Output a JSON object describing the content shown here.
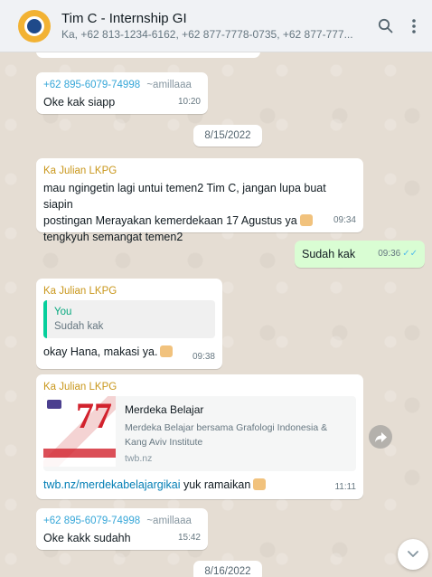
{
  "header": {
    "title": "Tim C - Internship GI",
    "members": "Ka, +62 813-1234-6162, +62 877-7778-0735, +62 877-777...",
    "search_icon": "search-icon",
    "menu_icon": "menu-icon"
  },
  "messages": [
    {
      "sender_phone": "+62 895-6079-74998",
      "sender_alias": "~amillaaa",
      "text": "Oke kak siapp",
      "time": "10:20"
    },
    {
      "date": "8/15/2022"
    },
    {
      "sender": "Ka Julian LKPG",
      "text_line1": "mau ngingetin lagi untui temen2 Tim C, jangan lupa buat siapin",
      "text_line2": "postingan Merayakan kemerdekaan 17 Agustus ya",
      "text_line3": "tengkyuh semangat temen2",
      "time": "09:34"
    },
    {
      "text": "Sudah kak",
      "time": "09:36",
      "ticks": "✓✓"
    },
    {
      "sender": "Ka Julian LKPG",
      "quote_author": "You",
      "quote_text": "Sudah kak",
      "text": "okay Hana, makasi ya.",
      "time": "09:38"
    },
    {
      "sender": "Ka Julian LKPG",
      "link_title": "Merdeka Belajar",
      "link_desc": "Merdeka Belajar bersama Grafologi Indonesia & Kang Aviv Institute",
      "link_domain": "twb.nz",
      "url": "twb.nz/merdekabelajargikai",
      "text": " yuk ramaikan",
      "time": "11:11",
      "thumb_text": "77"
    },
    {
      "sender_phone": "+62 895-6079-74998",
      "sender_alias": "~amillaaa",
      "text": "Oke kakk sudahh",
      "time": "15:42"
    },
    {
      "date": "8/16/2022"
    }
  ],
  "colors": {
    "header_bg": "#f0f2f5",
    "outgoing_bubble": "#d9fdd3",
    "phone_sender": "#35a6d8",
    "julian_sender": "#c9971c",
    "link": "#027eb5"
  }
}
